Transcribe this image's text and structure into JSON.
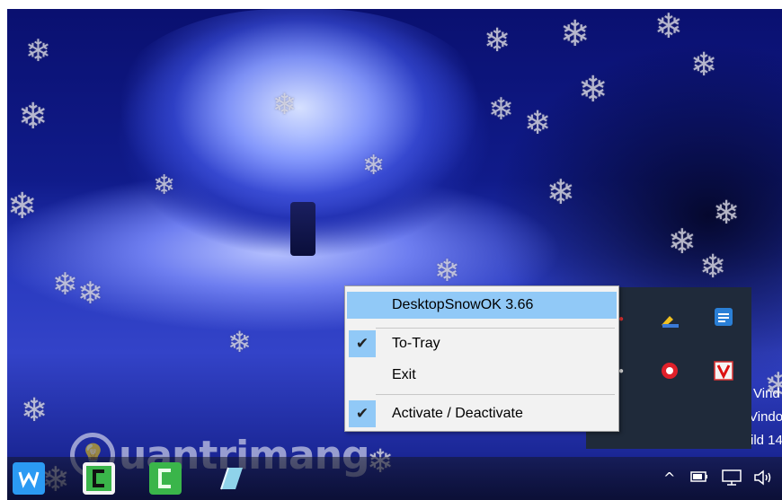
{
  "context_menu": {
    "items": [
      {
        "label": "DesktopSnowOK 3.66",
        "checked": false,
        "highlighted": true
      },
      {
        "label": "To-Tray",
        "checked": true,
        "highlighted": false
      },
      {
        "label": "Exit",
        "checked": false,
        "highlighted": false
      },
      {
        "label": "Activate / Deactivate",
        "checked": true,
        "highlighted": false
      }
    ]
  },
  "watermark": {
    "text": "uantrimang"
  },
  "desktop_partial_text": [
    "Vind",
    "Vindo",
    "ild 14"
  ],
  "taskbar": {
    "apps": [
      {
        "icon": "word-app-icon",
        "color": "#2b9af3"
      },
      {
        "icon": "camtasia-app-icon",
        "color": "#3ab54a"
      },
      {
        "icon": "camtasia-recorder-app-icon",
        "color": "#3ab54a"
      },
      {
        "icon": "notes-app-icon",
        "color": "#7fd0e8"
      }
    ],
    "system_icons": [
      "chevron-up-icon",
      "battery-icon",
      "network-icon",
      "volume-icon"
    ]
  },
  "tray_panel": {
    "icons": [
      "cleaner-broom-icon",
      "blue-app-icon",
      "red-gear-icon",
      "v-app-icon"
    ]
  },
  "colors": {
    "menu_highlight": "#91c9f7",
    "menu_bg": "#f2f2f2",
    "desktop_blue": "#1c2aa8"
  }
}
